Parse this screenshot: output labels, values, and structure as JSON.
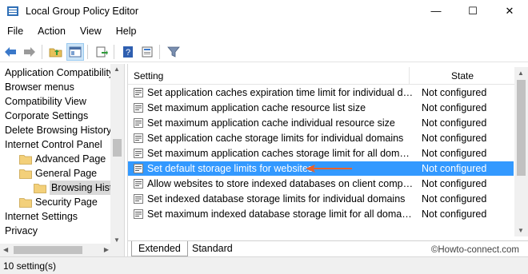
{
  "window": {
    "title": "Local Group Policy Editor",
    "minimize_glyph": "—",
    "maximize_glyph": "☐",
    "close_glyph": "✕"
  },
  "menu": [
    "File",
    "Action",
    "View",
    "Help"
  ],
  "toolbar": {
    "buttons": [
      "back-arrow-icon",
      "forward-arrow-icon",
      "up-folder-icon",
      "show-hide-tree-icon",
      "export-list-icon",
      "help-icon",
      "properties-icon",
      "filter-icon"
    ]
  },
  "tree": {
    "items": [
      {
        "label": "Application Compatibility",
        "indent": 0,
        "folder": false
      },
      {
        "label": "Browser menus",
        "indent": 0,
        "folder": false
      },
      {
        "label": "Compatibility View",
        "indent": 0,
        "folder": false
      },
      {
        "label": "Corporate Settings",
        "indent": 0,
        "folder": false
      },
      {
        "label": "Delete Browsing History",
        "indent": 0,
        "folder": false
      },
      {
        "label": "Internet Control Panel",
        "indent": 0,
        "folder": false
      },
      {
        "label": "Advanced Page",
        "indent": 1,
        "folder": true
      },
      {
        "label": "General Page",
        "indent": 1,
        "folder": true
      },
      {
        "label": "Browsing History",
        "indent": 2,
        "folder": true,
        "selected": true
      },
      {
        "label": "Security Page",
        "indent": 1,
        "folder": true
      },
      {
        "label": "Internet Settings",
        "indent": 0,
        "folder": false
      },
      {
        "label": "Privacy",
        "indent": 0,
        "folder": false
      }
    ]
  },
  "list": {
    "header": {
      "setting": "Setting",
      "state": "State"
    },
    "rows": [
      {
        "setting": "Set application caches expiration time limit for individual do...",
        "state": "Not configured"
      },
      {
        "setting": "Set maximum application cache resource list size",
        "state": "Not configured"
      },
      {
        "setting": "Set maximum application cache individual resource size",
        "state": "Not configured"
      },
      {
        "setting": "Set application cache storage limits for individual domains",
        "state": "Not configured"
      },
      {
        "setting": "Set maximum application caches storage limit for all domains",
        "state": "Not configured"
      },
      {
        "setting": "Set default storage limits for websites",
        "state": "Not configured",
        "selected": true
      },
      {
        "setting": "Allow websites to store indexed databases on client comput...",
        "state": "Not configured"
      },
      {
        "setting": "Set indexed database storage limits for individual domains",
        "state": "Not configured"
      },
      {
        "setting": "Set maximum indexed database storage limit for all domains",
        "state": "Not configured"
      }
    ]
  },
  "tabs": {
    "extended": "Extended",
    "standard": "Standard",
    "active": "Extended"
  },
  "watermark": "©Howto-connect.com",
  "status": "10 setting(s)",
  "colors": {
    "selection": "#3399ff",
    "annotation_arrow": "#e8622c"
  }
}
